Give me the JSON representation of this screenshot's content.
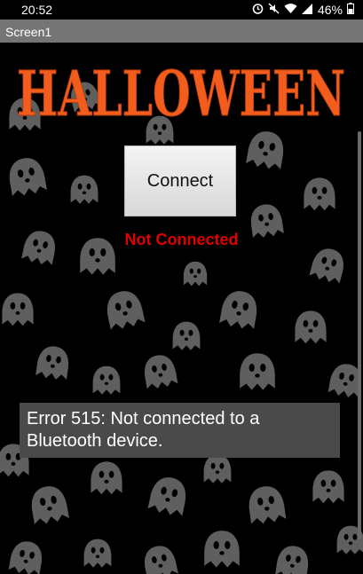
{
  "status_bar": {
    "time": "20:52",
    "battery": "46%"
  },
  "title_bar": {
    "title": "Screen1"
  },
  "logo": {
    "text": "HALLOWEEN",
    "color": "#f25c1c"
  },
  "connect_button": {
    "label": "Connect"
  },
  "connection_status": {
    "text": "Not Connected",
    "color": "#e00000"
  },
  "error_message": {
    "text": "Error 515: Not connected to a Bluetooth device."
  },
  "colors": {
    "background": "#000000",
    "ghost": "#5f5f5f",
    "title_bar": "#757575"
  }
}
